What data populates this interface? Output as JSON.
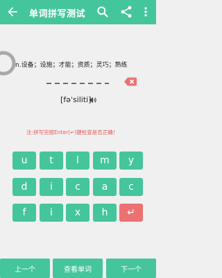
{
  "header": {
    "title": "单词拼写测试"
  },
  "question": {
    "definition": "n.设备；设施；才能；资质；灵巧；熟练",
    "phonetic": "[fəˈsiliti]",
    "answer_slots": 8
  },
  "note": "注:拼写完按Enter(↵)键检查是否正确！",
  "keypad": {
    "rows": [
      [
        "u",
        "t",
        "l",
        "m",
        "y"
      ],
      [
        "d",
        "i",
        "c",
        "a",
        "c"
      ],
      [
        "f",
        "i",
        "x",
        "h",
        "↵"
      ]
    ]
  },
  "bottom": {
    "prev_label": "上一个",
    "view_label": "查看单词",
    "next_label": "下一个"
  },
  "colors": {
    "primary": "#45c59c",
    "accent_red": "#ec7272",
    "note_red": "#e45b5b"
  }
}
